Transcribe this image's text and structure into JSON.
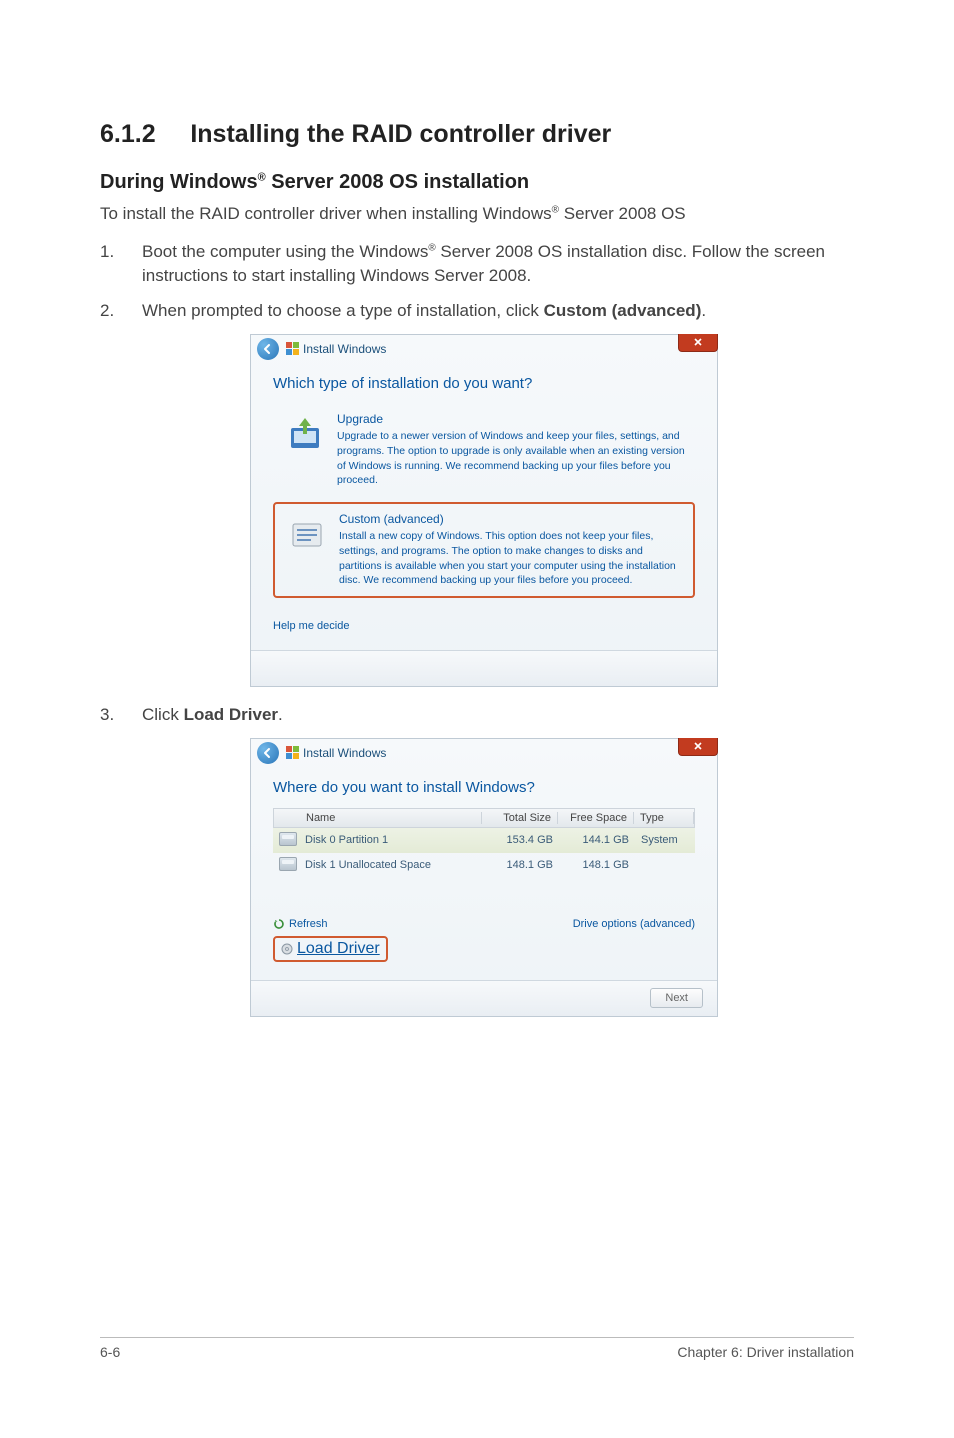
{
  "headings": {
    "section_number": "6.1.2",
    "section_title": "Installing the RAID controller driver",
    "subheading_prefix": "During Windows",
    "subheading_suffix": " Server 2008 OS installation"
  },
  "intro_para": {
    "prefix": "To install the RAID controller driver when installing Windows",
    "suffix": " Server 2008 OS"
  },
  "steps": [
    {
      "num": "1.",
      "prefix": "Boot the computer using the Windows",
      "suffix": " Server 2008 OS installation disc. Follow the screen instructions to start installing Windows Server 2008."
    },
    {
      "num": "2.",
      "text_before_bold": "When prompted to choose a type of installation, click ",
      "bold": "Custom (advanced)",
      "after": "."
    },
    {
      "num": "3.",
      "text_before_bold": "Click ",
      "bold": "Load Driver",
      "after": "."
    }
  ],
  "dialog1": {
    "title": "Install Windows",
    "prompt": "Which type of installation do you want?",
    "upgrade": {
      "title": "Upgrade",
      "desc": "Upgrade to a newer version of Windows and keep your files, settings, and programs. The option to upgrade is only available when an existing version of Windows is running. We recommend backing up your files before you proceed."
    },
    "custom": {
      "title": "Custom (advanced)",
      "desc": "Install a new copy of Windows. This option does not keep your files, settings, and programs. The option to make changes to disks and partitions is available when you start your computer using the installation disc. We recommend backing up your files before you proceed."
    },
    "help": "Help me decide"
  },
  "dialog2": {
    "title": "Install Windows",
    "prompt": "Where do you want to install Windows?",
    "cols": {
      "name": "Name",
      "total": "Total Size",
      "free": "Free Space",
      "type": "Type"
    },
    "rows": [
      {
        "name": "Disk 0 Partition 1",
        "total": "153.4 GB",
        "free": "144.1 GB",
        "type": "System",
        "selected": true
      },
      {
        "name": "Disk 1 Unallocated Space",
        "total": "148.1 GB",
        "free": "148.1 GB",
        "type": "",
        "selected": false
      }
    ],
    "refresh": "Refresh",
    "load_driver": "Load Driver",
    "drive_options": "Drive options (advanced)",
    "next": "Next"
  },
  "footer": {
    "left": "6-6",
    "right": "Chapter 6: Driver installation"
  },
  "reg_mark": "®"
}
